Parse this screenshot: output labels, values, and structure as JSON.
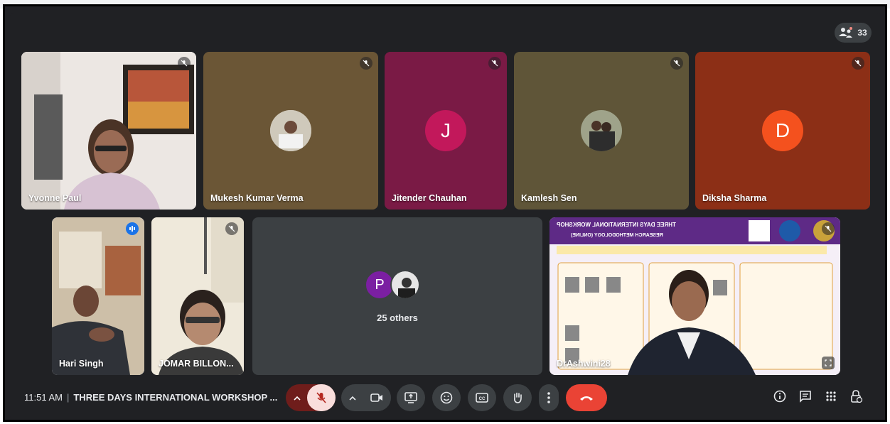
{
  "meeting": {
    "participant_count": "33",
    "time": "11:51 AM",
    "title": "THREE DAYS INTERNATIONAL WORKSHOP ...",
    "others_label": "25 others",
    "others_initial": "P"
  },
  "participants": [
    {
      "name": "Yvonne Paul",
      "mic": "muted"
    },
    {
      "name": "Mukesh Kumar Verma",
      "mic": "muted"
    },
    {
      "name": "Jitender Chauhan",
      "initial": "J",
      "avatar_color": "#c2185b",
      "mic": "muted"
    },
    {
      "name": "Kamlesh Sen",
      "mic": "muted"
    },
    {
      "name": "Diksha Sharma",
      "initial": "D",
      "avatar_color": "#f4511e",
      "mic": "muted"
    },
    {
      "name": "Hari Singh",
      "mic": "speaking"
    },
    {
      "name": "JOMAR BILLON...",
      "mic": "muted"
    },
    {
      "name": "DrAshwini28",
      "mic": "muted"
    }
  ],
  "poster": {
    "title": "THREE DAYS INTERNATIONAL WORKSHOP",
    "subtitle": "RESEARCH METHODOLOGY (ONLINE)"
  },
  "colors": {
    "background": "#202124",
    "control_bg": "#3c4043",
    "mic_muted_bg": "#6f1d1b",
    "end_call": "#ea4335",
    "accent_blue": "#8ab4f8"
  },
  "controls": {
    "mic_muted": true,
    "camera_off": false,
    "icons": [
      "mic-off-icon",
      "camera-icon",
      "present-icon",
      "emoji-icon",
      "captions-icon",
      "raise-hand-icon",
      "more-icon",
      "end-call-icon"
    ],
    "right_icons": [
      "info-icon",
      "chat-icon",
      "activities-icon",
      "host-controls-icon"
    ]
  }
}
